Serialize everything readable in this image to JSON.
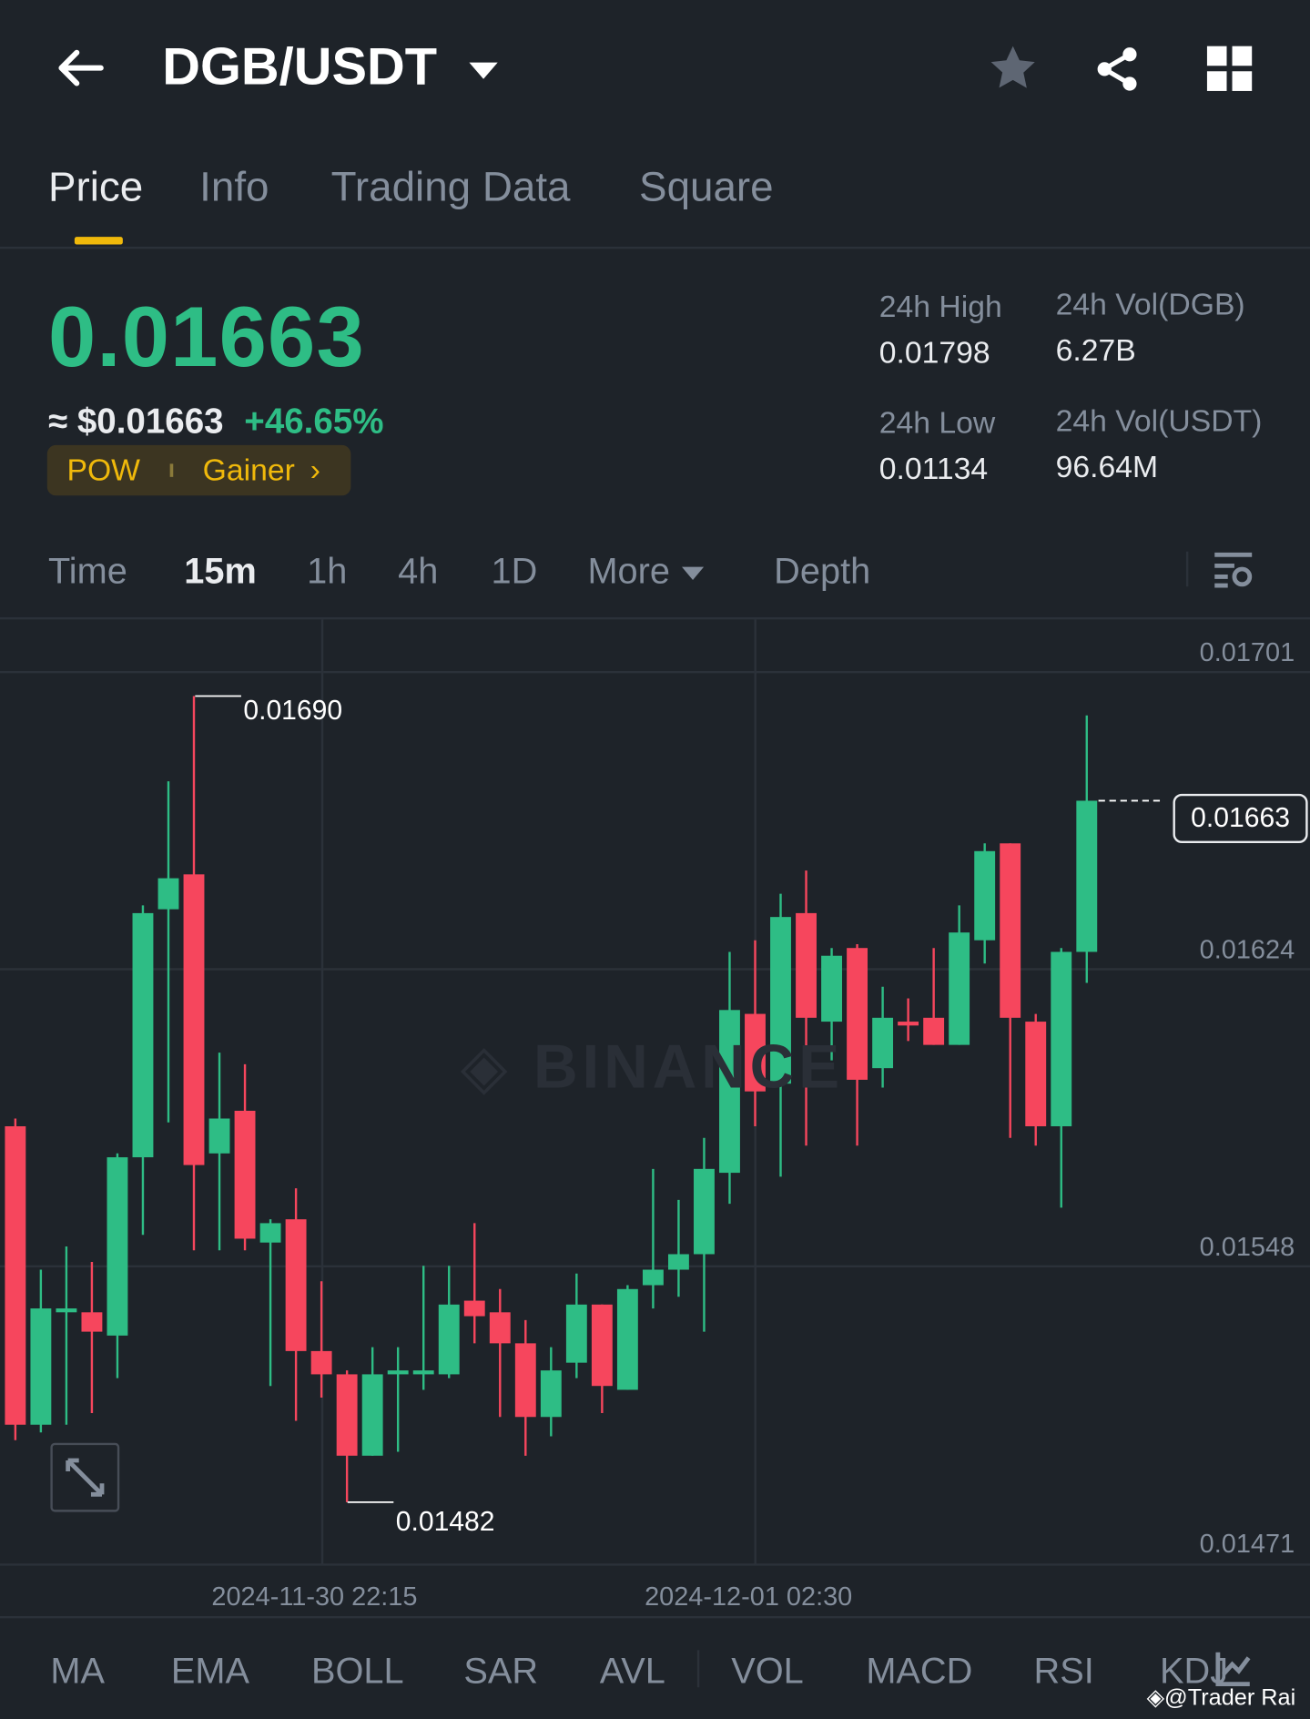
{
  "header": {
    "pair": "DGB/USDT"
  },
  "tabs": [
    "Price",
    "Info",
    "Trading Data",
    "Square"
  ],
  "ticker": {
    "last_price": "0.01663",
    "usd_price": "≈ $0.01663",
    "change": "+46.65%",
    "tags": [
      "POW",
      "Gainer"
    ],
    "high_label": "24h High",
    "high": "0.01798",
    "low_label": "24h Low",
    "low": "0.01134",
    "vol_base_label": "24h Vol(DGB)",
    "vol_base": "6.27B",
    "vol_quote_label": "24h Vol(USDT)",
    "vol_quote": "96.64M"
  },
  "timeframes": {
    "time": "Time",
    "items": [
      "15m",
      "1h",
      "4h",
      "1D"
    ],
    "more": "More",
    "depth": "Depth",
    "active": "15m"
  },
  "indicators": [
    "MA",
    "EMA",
    "BOLL",
    "SAR",
    "AVL",
    "VOL",
    "MACD",
    "RSI",
    "KDJ"
  ],
  "watermark": "BINANCE",
  "credit": "@Trader Rai",
  "colors": {
    "up": "#2ebd85",
    "down": "#f6465d",
    "accent": "#f0b90b",
    "bg": "#1e2329"
  },
  "chart_data": {
    "type": "candlestick",
    "y_ticks": [
      "0.01701",
      "0.01624",
      "0.01548",
      "0.01471"
    ],
    "ylim": [
      0.01471,
      0.01701
    ],
    "x_ticks": [
      "2024-11-30 22:15",
      "2024-12-01 02:30"
    ],
    "high_marker": "0.01690",
    "low_marker": "0.01482",
    "last_marker": "0.01663",
    "candles": [
      [
        0.01579,
        0.01581,
        0.01498,
        0.01502
      ],
      [
        0.01502,
        0.01542,
        0.015,
        0.01532
      ],
      [
        0.01531,
        0.01548,
        0.01502,
        0.01532
      ],
      [
        0.01531,
        0.01544,
        0.01505,
        0.01526
      ],
      [
        0.01525,
        0.01572,
        0.01514,
        0.01571
      ],
      [
        0.01571,
        0.01636,
        0.01551,
        0.01634
      ],
      [
        0.01635,
        0.01668,
        0.0158,
        0.01643
      ],
      [
        0.01644,
        0.0169,
        0.01547,
        0.01569
      ],
      [
        0.01572,
        0.01598,
        0.01547,
        0.01581
      ],
      [
        0.01583,
        0.01595,
        0.01547,
        0.0155
      ],
      [
        0.01549,
        0.01555,
        0.01512,
        0.01554
      ],
      [
        0.01555,
        0.01563,
        0.01503,
        0.01521
      ],
      [
        0.01521,
        0.01539,
        0.01509,
        0.01515
      ],
      [
        0.01515,
        0.01516,
        0.01482,
        0.01494
      ],
      [
        0.01494,
        0.01522,
        0.01494,
        0.01515
      ],
      [
        0.01515,
        0.01522,
        0.01495,
        0.01516
      ],
      [
        0.01515,
        0.01543,
        0.01511,
        0.01516
      ],
      [
        0.01515,
        0.01543,
        0.01514,
        0.01533
      ],
      [
        0.01534,
        0.01554,
        0.01523,
        0.0153
      ],
      [
        0.01531,
        0.01537,
        0.01504,
        0.01523
      ],
      [
        0.01523,
        0.01529,
        0.01494,
        0.01504
      ],
      [
        0.01504,
        0.01522,
        0.01499,
        0.01516
      ],
      [
        0.01518,
        0.01541,
        0.01514,
        0.01533
      ],
      [
        0.01533,
        0.01533,
        0.01505,
        0.01512
      ],
      [
        0.01511,
        0.01538,
        0.01511,
        0.01537
      ],
      [
        0.01538,
        0.01568,
        0.01532,
        0.01542
      ],
      [
        0.01542,
        0.0156,
        0.01535,
        0.01546
      ],
      [
        0.01546,
        0.01576,
        0.01526,
        0.01568
      ],
      [
        0.01567,
        0.01624,
        0.01559,
        0.01609
      ],
      [
        0.01608,
        0.01627,
        0.01579,
        0.01588
      ],
      [
        0.0159,
        0.01639,
        0.01566,
        0.01633
      ],
      [
        0.01634,
        0.01645,
        0.01574,
        0.01607
      ],
      [
        0.01606,
        0.01625,
        0.01596,
        0.01623
      ],
      [
        0.01625,
        0.01626,
        0.01574,
        0.01591
      ],
      [
        0.01594,
        0.01615,
        0.01589,
        0.01607
      ],
      [
        0.01606,
        0.01612,
        0.01601,
        0.01605
      ],
      [
        0.01607,
        0.01625,
        0.016,
        0.016
      ],
      [
        0.016,
        0.01636,
        0.016,
        0.01629
      ],
      [
        0.01627,
        0.01652,
        0.01621,
        0.0165
      ],
      [
        0.01652,
        0.01652,
        0.01576,
        0.01607
      ],
      [
        0.01606,
        0.01608,
        0.01574,
        0.01579
      ],
      [
        0.01579,
        0.01625,
        0.01558,
        0.01624
      ],
      [
        0.01624,
        0.01685,
        0.01616,
        0.01663
      ]
    ]
  }
}
